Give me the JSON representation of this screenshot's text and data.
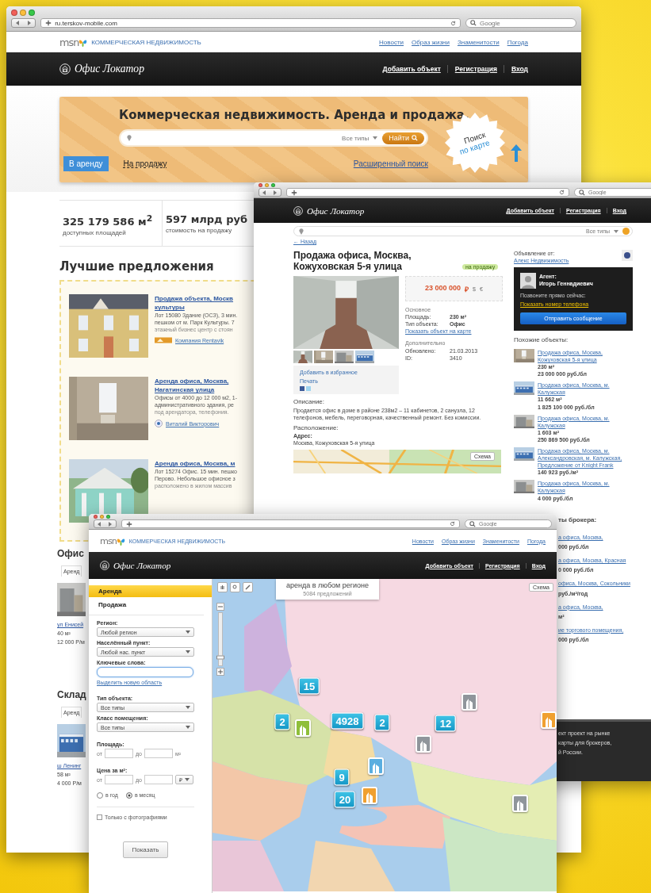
{
  "main_page": {
    "browser": {
      "url": "ru.terskov-mobile.com",
      "search_placeholder": "Google"
    },
    "msn_bar": {
      "brand": "msn",
      "section": "КОММЕРЧЕСКАЯ НЕДВИЖИМОСТЬ",
      "links": [
        "Новости",
        "Образ жизни",
        "Знаменитости",
        "Погода"
      ]
    },
    "header": {
      "logo": "Офис Локатор",
      "nav": [
        "Добавить объект",
        "Регистрация",
        "Вход"
      ]
    },
    "hero": {
      "title": "Коммерческая недвижимость. Аренда и продажа.",
      "type_select": "Все типы",
      "search_button": "Найти",
      "map_search": [
        "Поиск",
        "по карте"
      ],
      "deal_tabs": [
        {
          "label": "В аренду",
          "selected": true
        },
        {
          "label": "На продажу",
          "selected": false
        }
      ],
      "advanced_link": "Расширенный поиск"
    },
    "stats": [
      {
        "value": "325 179 586 м$^{2}$",
        "caption": "доступных площадей"
      },
      {
        "value": "597 млрд руб",
        "caption": "стоимость на продажу"
      }
    ],
    "best_offers": {
      "heading": "Лучшие предложения",
      "listings": [
        {
          "title_lines": [
            "Продажа объекта, Москв",
            "культуры"
          ],
          "description_lines": [
            "Лот 15080 Здание (ОСЗ), 3 мин.",
            "пешком от м. Парк Культуры. 7",
            "этажный бизнес центр с стоян"
          ],
          "agent": "Компания Rentavik",
          "kind": "logo"
        },
        {
          "title_lines": [
            "Аренда офиса, Москва,",
            "Нагатинская улица"
          ],
          "description_lines": [
            "Офисы от 4000 до 12 000 м2, 1-",
            "административного здания, ре",
            "под арендатора, телефония."
          ],
          "agent": "Виталий Викторович",
          "kind": "avatar"
        },
        {
          "title_lines": [
            "Аренда офиса, Москва, м"
          ],
          "description_lines": [
            "Лот 15274 Офис. 15 мин. пешко",
            "Перово. Небольшое офисное з",
            "расположено в жилом массив"
          ]
        }
      ]
    },
    "sections": [
      {
        "heading": "Офис",
        "tab": "Аренд",
        "link": "ул Енисей",
        "area": "40 м²",
        "price": "12 000 Р/м"
      },
      {
        "heading": "Склад",
        "tab": "Аренд",
        "link": "ш Ленинг",
        "area": "58 м²",
        "price": "4 000 Р/м"
      }
    ]
  },
  "listing_page": {
    "browser": {
      "search_placeholder": "Google"
    },
    "header": {
      "logo": "Офис Локатор",
      "nav": [
        "Добавить объект",
        "Регистрация",
        "Вход"
      ]
    },
    "search": {
      "type_select": "Все типы"
    },
    "back_link": "← Назад",
    "title": "Продажа офиса, Москва, Кожуховская 5-я улица",
    "status_badge": "на продажу",
    "price": {
      "amount": "23 000 000",
      "currencies": [
        {
          "label": "₽",
          "selected": true
        },
        {
          "label": "$",
          "selected": false
        },
        {
          "label": "€",
          "selected": false
        }
      ]
    },
    "main_params": {
      "heading": "Основное",
      "rows": [
        {
          "label": "Площадь:",
          "value": "230 м²"
        },
        {
          "label": "Тип объекта:",
          "value": "Офис"
        }
      ],
      "map_link": "Показать объект на карте"
    },
    "extra_params": {
      "heading": "Дополнительно",
      "rows": [
        {
          "label": "Обновлено:",
          "value": "21.03.2013"
        },
        {
          "label": "ID:",
          "value": "3410"
        }
      ]
    },
    "actions": [
      "Добавить в избранное",
      "Печать"
    ],
    "description": {
      "heading": "Описание:",
      "text": "Продается офис в доме в районе 238м2 – 11 кабинетов, 2 санузла, 12 телефонов, мебель, переговорная, качественный ремонт. Без комиссии."
    },
    "location": {
      "heading": "Расположение:",
      "address_label": "Адрес:",
      "address": "Москва, Кожуховская 5-я улица",
      "map_type": "Схема"
    },
    "seller": {
      "label": "Объявление от:",
      "name": "Алекс Недвижимость"
    },
    "agent": {
      "label": "Агент:",
      "name": "Игорь Геннадиевич",
      "call_text": "Позвоните прямо сейчас:",
      "phone_link": "Показать номер телефона",
      "message_button": "Отправить сообщение"
    },
    "similar": {
      "heading": "Похожие объекты:",
      "items": [
        {
          "link": "Продажа офиса, Москва, Кожуховская 5-я улица",
          "area": "230 м²",
          "price": "23 000 000 руб./бл"
        },
        {
          "link": "Продажа офиса, Москва, м. Калужская",
          "area": "11 662 м²",
          "price": "1 825 100 000 руб./бл"
        },
        {
          "link": "Продажа офиса, Москва, м. Калужская",
          "area": "1 603 м²",
          "price": "250 869 500 руб./бл"
        },
        {
          "link": "Продажа офиса, Москва, м. Александровская, м. Калужская, Предложение от Knight Frank",
          "price": "140 923 руб./м²"
        },
        {
          "link": "Продажа офиса, Москва, м. Калужская",
          "price": "4 000 руб./бл"
        }
      ]
    },
    "right_strip": [
      {
        "kind": "heading",
        "text": "ты брокера:"
      },
      {
        "kind": "link",
        "text": "а офиса, Москва,"
      },
      {
        "kind": "price",
        "text": "000 руб./бл"
      },
      {
        "kind": "link",
        "text": "а офиса, Москва, Красная"
      },
      {
        "kind": "price",
        "text": "0 000 руб./бл"
      },
      {
        "kind": "link",
        "text": "офиса, Москва, Сокольники"
      },
      {
        "kind": "price",
        "text": "руб./м²/год"
      },
      {
        "kind": "link",
        "text": "а офиса, Москва,"
      },
      {
        "kind": "price",
        "text": "м²"
      },
      {
        "kind": "link",
        "text": "ие торгового помещения,"
      },
      {
        "kind": "price",
        "text": "000 руб./бл"
      }
    ],
    "footer_lines": [
      "ект проект на рынке",
      "карты для брокеров,",
      "й России."
    ]
  },
  "map_page": {
    "browser": {
      "search_placeholder": "Google"
    },
    "msn_bar": {
      "brand": "msn",
      "section": "КОММЕРЧЕСКАЯ НЕДВИЖИМОСТЬ",
      "links": [
        "Новости",
        "Образ жизни",
        "Знаменитости",
        "Погода"
      ]
    },
    "header": {
      "logo": "Офис Локатор",
      "nav": [
        "Добавить объект",
        "Регистрация",
        "Вход"
      ]
    },
    "deal_tabs": [
      {
        "label": "Аренда",
        "selected": true
      },
      {
        "label": "Продажа",
        "selected": false
      }
    ],
    "filters": [
      {
        "kind": "select",
        "label": "Регион:",
        "value": "Любой регион"
      },
      {
        "kind": "select",
        "label": "Населённый пункт:",
        "value": "Любой нас. пункт"
      },
      {
        "kind": "text",
        "label": "Ключевые слова:",
        "link": "Выделить новую область"
      },
      {
        "kind": "select",
        "label": "Тип объекта:",
        "value": "Все типы"
      },
      {
        "kind": "select",
        "label": "Класс помещения:",
        "value": "Все типы"
      },
      {
        "kind": "range",
        "label": "Площадь:",
        "from": "от",
        "to": "до",
        "unit": "м²"
      },
      {
        "kind": "range",
        "label": "Цена за м²:",
        "from": "от",
        "to": "до",
        "unit": "₽",
        "unit_select": true
      }
    ],
    "period": [
      {
        "label": "в год",
        "selected": false
      },
      {
        "label": "в месяц",
        "selected": true
      }
    ],
    "photos_only": {
      "label": "Только с фотографиями",
      "checked": false
    },
    "show_button": "Показать",
    "map": {
      "title": "аренда в любом регионе",
      "subtitle": "5084 предложений",
      "map_type": "Схема",
      "zoom": {
        "level": 0.15
      },
      "clusters": [
        {
          "count": "15"
        },
        {
          "count": "2"
        },
        {
          "count": "4928"
        },
        {
          "count": "2"
        },
        {
          "count": "12"
        },
        {
          "count": "9"
        },
        {
          "count": "20"
        }
      ],
      "pins": [
        {
          "color": "#8f959b"
        },
        {
          "color": "#8fbf3a"
        },
        {
          "color": "#8f959b"
        },
        {
          "color": "#5aaee0"
        },
        {
          "color": "#f0a030"
        },
        {
          "color": "#8f959b"
        },
        {
          "color": "#f0a030"
        }
      ]
    }
  }
}
